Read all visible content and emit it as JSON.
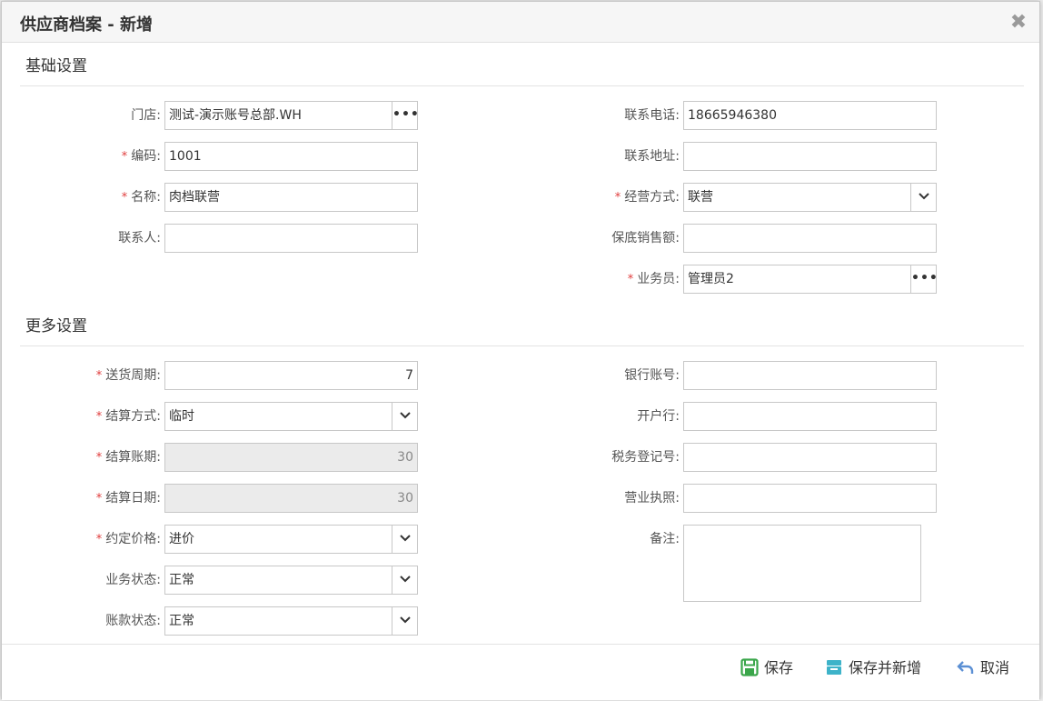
{
  "dialog": {
    "title": "供应商档案 - 新增",
    "close_glyph": "✖"
  },
  "sections": {
    "basic": "基础设置",
    "more": "更多设置"
  },
  "basic": {
    "store": {
      "label": "门店:",
      "value": "测试-演示账号总部.WH",
      "button": "•••"
    },
    "code": {
      "label": "编码:",
      "required": "*",
      "value": "1001"
    },
    "name": {
      "label": "名称:",
      "required": "*",
      "value": "肉档联营"
    },
    "contact": {
      "label": "联系人:",
      "value": ""
    },
    "phone": {
      "label": "联系电话:",
      "value": "18665946380"
    },
    "address": {
      "label": "联系地址:",
      "value": ""
    },
    "mode": {
      "label": "经营方式:",
      "required": "*",
      "value": "联营"
    },
    "min_sales": {
      "label": "保底销售额:",
      "value": ""
    },
    "salesman": {
      "label": "业务员:",
      "required": "*",
      "value": "管理员2",
      "button": "•••"
    }
  },
  "more": {
    "delivery_cycle": {
      "label": "送货周期:",
      "required": "*",
      "value": "7"
    },
    "settle_method": {
      "label": "结算方式:",
      "required": "*",
      "value": "临时"
    },
    "settle_period": {
      "label": "结算账期:",
      "required": "*",
      "value": "30"
    },
    "settle_date": {
      "label": "结算日期:",
      "required": "*",
      "value": "30"
    },
    "agreed_price": {
      "label": "约定价格:",
      "required": "*",
      "value": "进价"
    },
    "biz_status": {
      "label": "业务状态:",
      "value": "正常"
    },
    "account_status": {
      "label": "账款状态:",
      "value": "正常"
    },
    "bank_account": {
      "label": "银行账号:",
      "value": ""
    },
    "bank": {
      "label": "开户行:",
      "value": ""
    },
    "tax_no": {
      "label": "税务登记号:",
      "value": ""
    },
    "license": {
      "label": "营业执照:",
      "value": ""
    },
    "remark": {
      "label": "备注:",
      "value": ""
    }
  },
  "footer": {
    "save": "保存",
    "save_new": "保存并新增",
    "cancel": "取消"
  },
  "colors": {
    "required": "#e03c3c",
    "save_icon": "#3aa64a",
    "save_new_icon": "#3db3c9",
    "cancel_icon": "#5b8fd4"
  },
  "icons": {
    "save": "save-icon",
    "save_new": "inbox-icon",
    "cancel": "undo-icon",
    "dropdown": "chevron-down-icon",
    "picker": "ellipsis-icon"
  }
}
